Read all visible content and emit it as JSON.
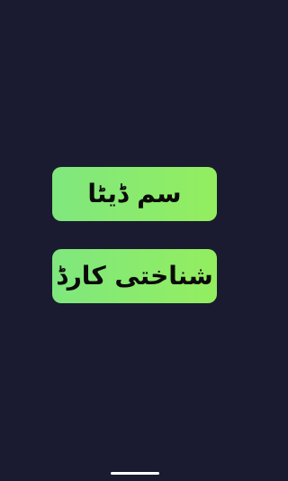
{
  "menu": {
    "items": [
      {
        "label": "سم ڈیٹا"
      },
      {
        "label": "شناختی کارڈ"
      }
    ]
  },
  "colors": {
    "background": "#1a1b30",
    "button_gradient_start": "#7fe77e",
    "button_gradient_end": "#93ee5f",
    "button_text": "#0b0b0b",
    "nav_handle": "#ffffff"
  }
}
